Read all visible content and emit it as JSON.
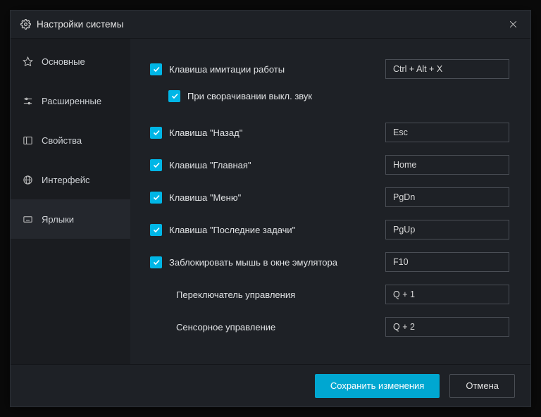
{
  "window": {
    "title": "Настройки системы"
  },
  "sidebar": {
    "items": [
      {
        "label": "Основные"
      },
      {
        "label": "Расширенные"
      },
      {
        "label": "Свойства"
      },
      {
        "label": "Интерфейс"
      },
      {
        "label": "Ярлыки"
      }
    ]
  },
  "settings": {
    "sim_key": {
      "label": "Клавиша имитации работы",
      "value": "Ctrl + Alt + X",
      "checked": true
    },
    "sim_mute": {
      "label": "При сворачивании выкл. звук",
      "checked": true
    },
    "back_key": {
      "label": "Клавиша \"Назад\"",
      "value": "Esc",
      "checked": true
    },
    "home_key": {
      "label": "Клавиша \"Главная\"",
      "value": "Home",
      "checked": true
    },
    "menu_key": {
      "label": "Клавиша \"Меню\"",
      "value": "PgDn",
      "checked": true
    },
    "recent_key": {
      "label": "Клавиша \"Последние задачи\"",
      "value": "PgUp",
      "checked": true
    },
    "lock_mouse": {
      "label": "Заблокировать мышь в окне эмулятора",
      "value": "F10",
      "checked": true
    },
    "ctrl_switch": {
      "label": "Переключатель управления",
      "value": "Q + 1"
    },
    "touch_ctrl": {
      "label": "Сенсорное управление",
      "value": "Q + 2"
    }
  },
  "footer": {
    "save": "Сохранить изменения",
    "cancel": "Отмена"
  }
}
